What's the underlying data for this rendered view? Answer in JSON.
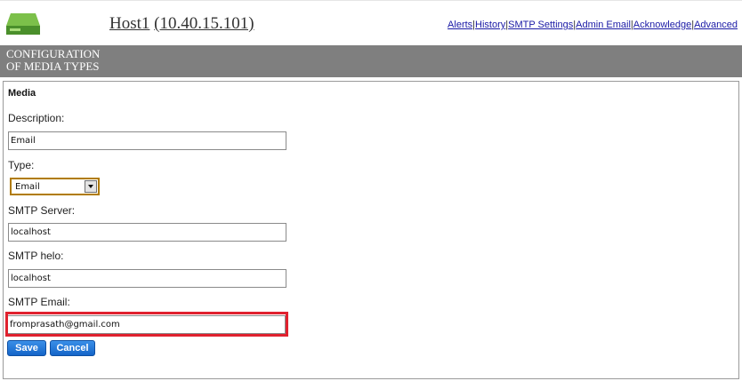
{
  "header": {
    "host_name": "Host1",
    "host_ip": "(10.40.15.101)",
    "logo_icon": "green-drive-icon",
    "nav": [
      "Alerts",
      "History",
      "SMTP Settings",
      "Admin Email",
      "Acknowledge",
      "Advanced"
    ],
    "nav_separator": "|"
  },
  "section": {
    "title_line1": "Configuration",
    "title_line2": "of Media Types"
  },
  "form": {
    "heading": "Media",
    "description_label": "Description:",
    "description_value": "Email",
    "type_label": "Type:",
    "type_value": "Email",
    "smtp_server_label": "SMTP Server:",
    "smtp_server_value": "localhost",
    "smtp_helo_label": "SMTP helo:",
    "smtp_helo_value": "localhost",
    "smtp_email_label": "SMTP Email:",
    "smtp_email_value": "fromprasath@gmail.com",
    "save_label": "Save",
    "cancel_label": "Cancel"
  },
  "colors": {
    "section_bar": "#7f7f7f",
    "highlight": "#e0212e",
    "button": "#1e74d6",
    "logo": "#5aa632"
  }
}
